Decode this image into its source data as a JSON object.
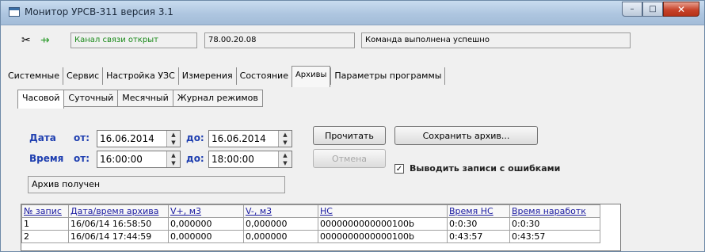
{
  "window": {
    "title": "Монитор УРСВ-311 версия 3.1",
    "controls": {
      "minimize": "–",
      "maximize": "□",
      "close": "✕"
    }
  },
  "status": {
    "icons": [
      "disconnect-icon",
      "connect-icon"
    ],
    "channel": "Канал связи открыт",
    "version": "78.00.20.08",
    "message": "Команда выполнена успешно",
    "channel_color": "#1a8a1a"
  },
  "tabs": [
    "Системные",
    "Сервис",
    "Настройка УЗС",
    "Измерения",
    "Состояние",
    "Архивы",
    "Параметры программы"
  ],
  "active_tab": "Архивы",
  "subtabs": [
    "Часовой",
    "Суточный",
    "Месячный",
    "Журнал режимов"
  ],
  "active_subtab": "Часовой",
  "form": {
    "date_label": "Дата",
    "time_label": "Время",
    "from_label": "от:",
    "to_label": "до:",
    "date_from": "16.06.2014",
    "date_to": "16.06.2014",
    "time_from": "16:00:00",
    "time_to": "18:00:00",
    "read_button": "Прочитать",
    "cancel_button": "Отмена",
    "save_button": "Сохранить архив...",
    "checkbox_label": "Выводить записи с ошибками",
    "checkbox_checked": true,
    "archive_status": "Архив получен"
  },
  "table": {
    "columns": [
      "№ запис",
      "Дата/время архива",
      "V+, м3",
      "V-, м3",
      "НС",
      "Время НС",
      "Время наработк"
    ],
    "rows": [
      [
        "1",
        "16/06/14 16:58:50",
        "0,000000",
        "0,000000",
        "0000000000000100b",
        "0:0:30",
        "0:0:30"
      ],
      [
        "2",
        "16/06/14 17:44:59",
        "0,000000",
        "0,000000",
        "0000000000000100b",
        "0:43:57",
        "0:43:57"
      ]
    ]
  }
}
